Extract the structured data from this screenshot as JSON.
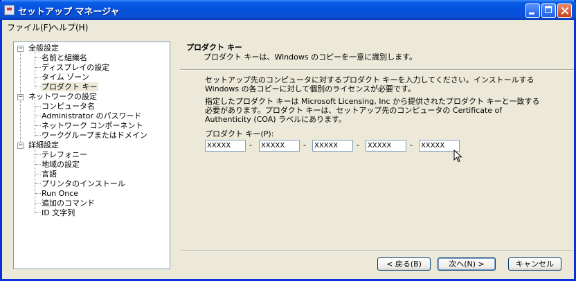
{
  "window": {
    "title": "セットアップ マネージャ"
  },
  "menu": {
    "file": "ファイル(F)",
    "help": "ヘルプ(H)"
  },
  "tree": {
    "general": "全般設定",
    "name_org": "名前と組織名",
    "display": "ディスプレイの設定",
    "timezone": "タイム ゾーン",
    "product_key": "プロダクト キー",
    "network": "ネットワークの設定",
    "computer_name": "コンピュータ名",
    "admin_password": "Administrator のパスワード",
    "network_components": "ネットワーク コンポーネント",
    "workgroup_domain": "ワークグループまたはドメイン",
    "advanced": "詳細設定",
    "telephony": "テレフォニー",
    "regional": "地域の設定",
    "languages": "言語",
    "printers": "プリンタのインストール",
    "run_once": "Run Once",
    "additional_commands": "追加のコマンド",
    "id_string": "ID 文字列"
  },
  "page": {
    "heading": "プロダクト キー",
    "subheading": "プロダクト キーは、Windows のコピーを一意に識別します。",
    "para1": "セットアップ先のコンピュータに対するプロダクト キーを入力してください。インストールする Windows の各コピーに対して個別のライセンスが必要です。",
    "para2": "指定したプロダクト キーは Microsoft Licensing, Inc から提供されたプロダクト キーと一致する必要があります。プロダクト キーは、セットアップ先のコンピュータの Certificate of Authenticity (COA) ラベルにあります。",
    "key_label": "プロダクト キー(P):",
    "key_fields": [
      "XXXXX",
      "XXXXX",
      "XXXXX",
      "XXXXX",
      "XXXXX"
    ],
    "dash": "-"
  },
  "buttons": {
    "back": "< 戻る(B)",
    "next": "次へ(N) >",
    "cancel": "キャンセル"
  }
}
